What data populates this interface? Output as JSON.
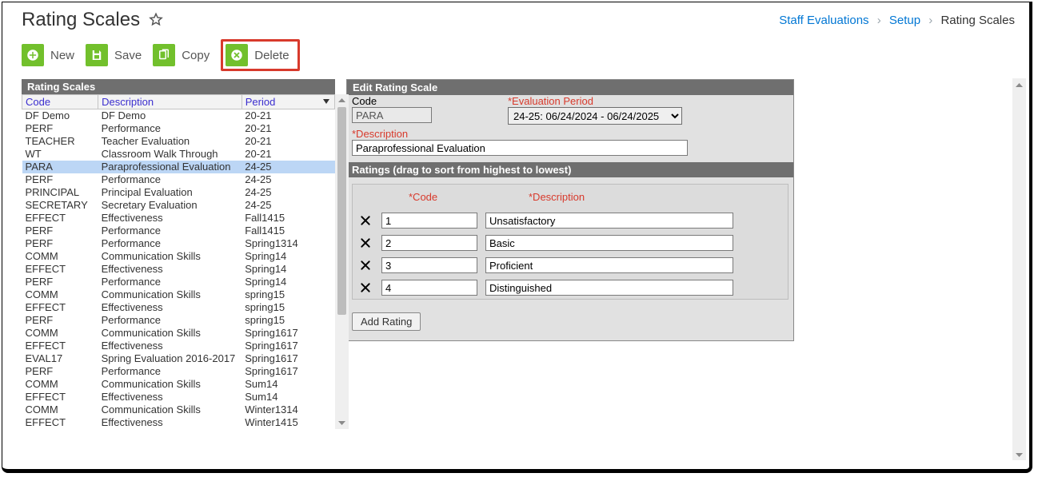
{
  "page": {
    "title": "Rating Scales"
  },
  "breadcrumb": {
    "items": [
      "Staff Evaluations",
      "Setup",
      "Rating Scales"
    ]
  },
  "toolbar": {
    "new_label": "New",
    "save_label": "Save",
    "copy_label": "Copy",
    "delete_label": "Delete"
  },
  "list": {
    "title": "Rating Scales",
    "columns": {
      "code": "Code",
      "description": "Description",
      "period": "Period"
    },
    "rows": [
      {
        "code": "DF Demo",
        "description": "DF Demo",
        "period": "20-21"
      },
      {
        "code": "PERF",
        "description": "Performance",
        "period": "20-21"
      },
      {
        "code": "TEACHER",
        "description": "Teacher Evaluation",
        "period": "20-21"
      },
      {
        "code": "WT",
        "description": "Classroom Walk Through",
        "period": "20-21"
      },
      {
        "code": "PARA",
        "description": "Paraprofessional Evaluation",
        "period": "24-25",
        "selected": true
      },
      {
        "code": "PERF",
        "description": "Performance",
        "period": "24-25"
      },
      {
        "code": "PRINCIPAL",
        "description": "Principal Evaluation",
        "period": "24-25"
      },
      {
        "code": "SECRETARY",
        "description": "Secretary Evaluation",
        "period": "24-25"
      },
      {
        "code": "EFFECT",
        "description": "Effectiveness",
        "period": "Fall1415"
      },
      {
        "code": "PERF",
        "description": "Performance",
        "period": "Fall1415"
      },
      {
        "code": "PERF",
        "description": "Performance",
        "period": "Spring1314"
      },
      {
        "code": "COMM",
        "description": "Communication Skills",
        "period": "Spring14"
      },
      {
        "code": "EFFECT",
        "description": "Effectiveness",
        "period": "Spring14"
      },
      {
        "code": "PERF",
        "description": "Performance",
        "period": "Spring14"
      },
      {
        "code": "COMM",
        "description": "Communication Skills",
        "period": "spring15"
      },
      {
        "code": "EFFECT",
        "description": "Effectiveness",
        "period": "spring15"
      },
      {
        "code": "PERF",
        "description": "Performance",
        "period": "spring15"
      },
      {
        "code": "COMM",
        "description": "Communication Skills",
        "period": "Spring1617"
      },
      {
        "code": "EFFECT",
        "description": "Effectiveness",
        "period": "Spring1617"
      },
      {
        "code": "EVAL17",
        "description": "Spring Evaluation 2016-2017",
        "period": "Spring1617"
      },
      {
        "code": "PERF",
        "description": "Performance",
        "period": "Spring1617"
      },
      {
        "code": "COMM",
        "description": "Communication Skills",
        "period": "Sum14"
      },
      {
        "code": "EFFECT",
        "description": "Effectiveness",
        "period": "Sum14"
      },
      {
        "code": "COMM",
        "description": "Communication Skills",
        "period": "Winter1314"
      },
      {
        "code": "EFFECT",
        "description": "Effectiveness",
        "period": "Winter1415"
      }
    ]
  },
  "edit": {
    "panel_title": "Edit Rating Scale",
    "code_label": "Code",
    "code_value": "PARA",
    "eval_period_label": "*Evaluation Period",
    "eval_period_value": "24-25: 06/24/2024 - 06/24/2025",
    "description_label": "*Description",
    "description_value": "Paraprofessional Evaluation",
    "ratings_header": "Ratings (drag to sort from highest to lowest)",
    "ratings_columns": {
      "code": "*Code",
      "description": "*Description"
    },
    "ratings": [
      {
        "code": "1",
        "description": "Unsatisfactory"
      },
      {
        "code": "2",
        "description": "Basic"
      },
      {
        "code": "3",
        "description": "Proficient"
      },
      {
        "code": "4",
        "description": "Distinguished"
      }
    ],
    "add_rating_label": "Add Rating"
  }
}
